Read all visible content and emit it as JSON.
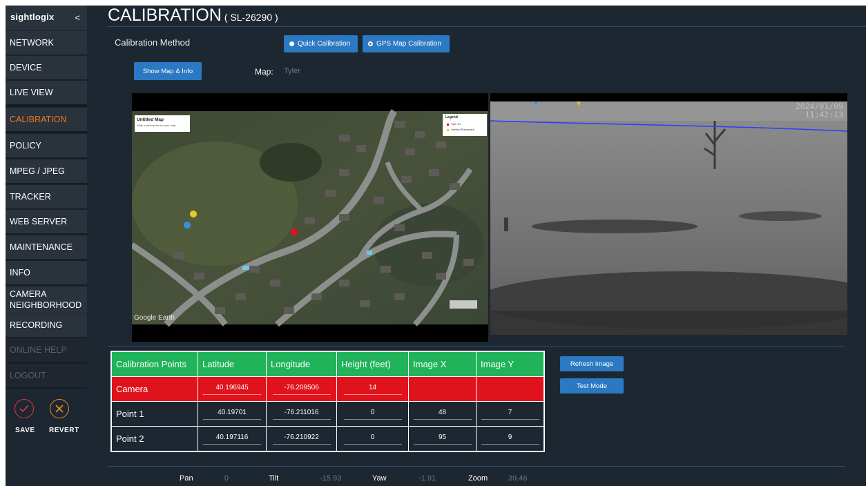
{
  "sidebar": {
    "logo": "sightlogix",
    "collapse_icon": "<",
    "items": [
      {
        "label": "NETWORK"
      },
      {
        "label": "DEVICE"
      },
      {
        "label": "LIVE VIEW"
      },
      {
        "label": "CALIBRATION"
      },
      {
        "label": "POLICY"
      },
      {
        "label": "MPEG / JPEG"
      },
      {
        "label": "TRACKER"
      },
      {
        "label": "WEB SERVER"
      },
      {
        "label": "MAINTENANCE"
      },
      {
        "label": "INFO"
      },
      {
        "label_line1": "CAMERA",
        "label_line2": "NEIGHBORHOOD"
      },
      {
        "label": "RECORDING"
      },
      {
        "label": "ONLINE HELP"
      },
      {
        "label": "LOGOUT"
      }
    ],
    "active": "CALIBRATION",
    "save_label": "SAVE",
    "revert_label": "REVERT"
  },
  "header": {
    "title": "CALIBRATION",
    "subtitle": "( SL-26290 )"
  },
  "calibration_method": {
    "label": "Calibration Method",
    "options": [
      "Quick Calibration",
      "GPS Map Calibration"
    ],
    "selected": "Quick Calibration"
  },
  "map_controls": {
    "show_map_label": "Show Map & Info",
    "map_label": "Map:",
    "map_name": "Tyler"
  },
  "map_view": {
    "card_title": "Untitled Map",
    "card_desc": "Write a description for your map.",
    "legend_title": "Legend",
    "legend_items": [
      "Tyler Dr",
      "Untitled Placemark"
    ],
    "watermark": "Google Earth"
  },
  "camera_view": {
    "date": "2024/01/09",
    "time": "11:42:13"
  },
  "table": {
    "headers": [
      "Calibration Points",
      "Latitude",
      "Longitude",
      "Height (feet)",
      "Image X",
      "Image Y"
    ],
    "rows": [
      {
        "name": "Camera",
        "lat": "40.196945",
        "lon": "-76.209506",
        "height": "14",
        "x": "",
        "y": ""
      },
      {
        "name": "Point 1",
        "lat": "40.19701",
        "lon": "-76.211016",
        "height": "0",
        "x": "48",
        "y": "7"
      },
      {
        "name": "Point 2",
        "lat": "40.197116",
        "lon": "-76.210922",
        "height": "0",
        "x": "95",
        "y": "9"
      }
    ]
  },
  "buttons": {
    "refresh": "Refresh Image",
    "test_mode": "Test Mode"
  },
  "ptz": {
    "pan_label": "Pan",
    "pan": "0",
    "tilt_label": "Tilt",
    "tilt": "-15.93",
    "yaw_label": "Yaw",
    "yaw": "-1.91",
    "zoom_label": "Zoom",
    "zoom": "39.46"
  },
  "colors": {
    "accent": "#2b79c2",
    "active_nav": "#f07a1d",
    "camera_row": "#e0131d",
    "header_row": "#21b35a"
  }
}
